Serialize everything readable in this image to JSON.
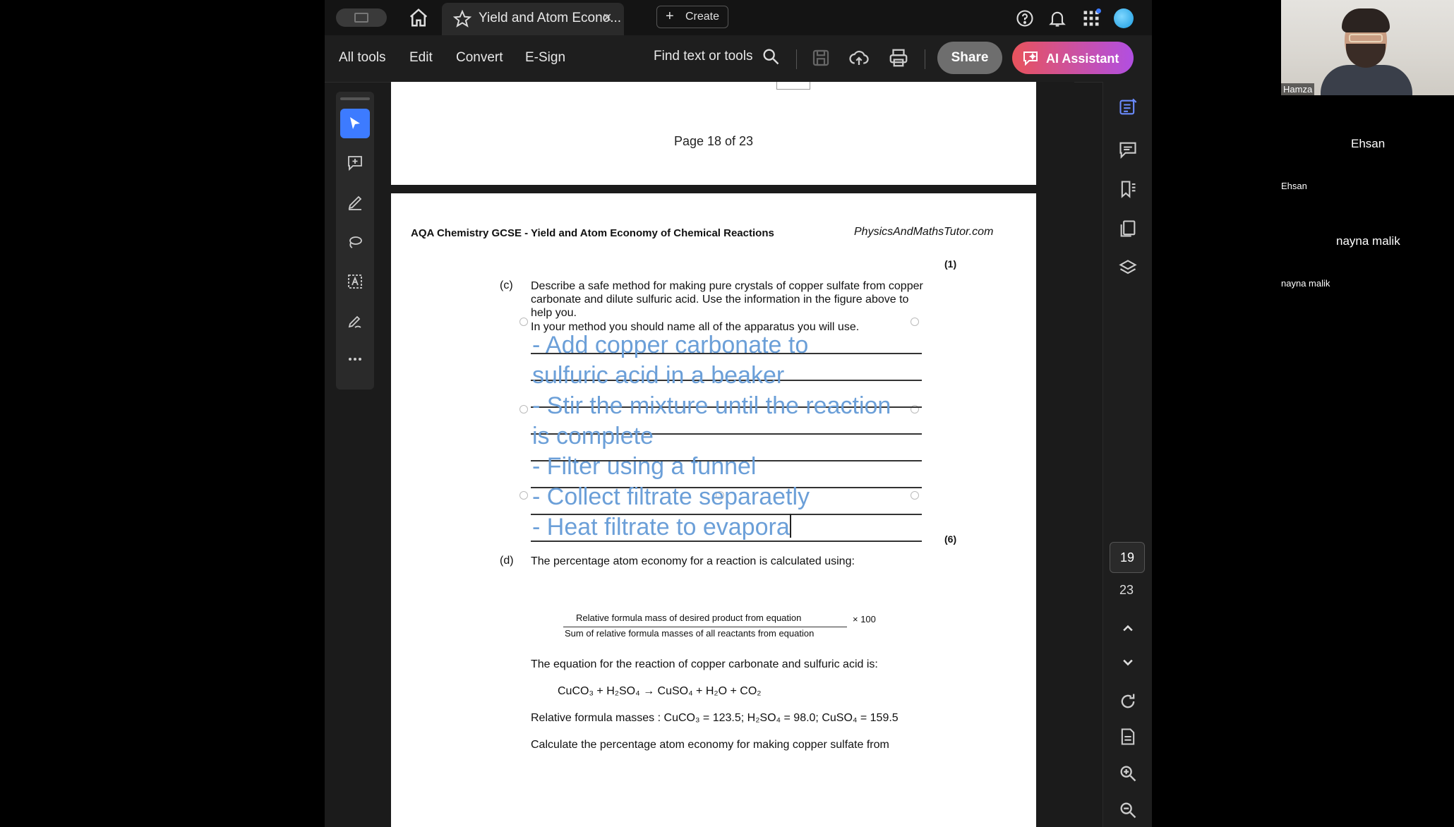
{
  "titlebar": {
    "tab_title": "Yield and Atom Econo...",
    "tab_close": "×",
    "create_label": "Create",
    "create_plus": "+"
  },
  "toolbar": {
    "menu": [
      "All tools",
      "Edit",
      "Convert",
      "E-Sign"
    ],
    "find_label": "Find text or tools",
    "share_label": "Share",
    "ai_label": "AI Assistant"
  },
  "document": {
    "prev_page_label": "Page  18  of  23",
    "header_left": "AQA Chemistry GCSE - Yield and Atom Economy of Chemical Reactions",
    "header_right": "PhysicsAndMathsTutor.com",
    "mark_top": "(1)",
    "q_c_label": "(c)",
    "q_c_text": "Describe a safe method for making pure crystals of copper sulfate from copper carbonate and dilute sulfuric acid. Use the information in the figure above to help you.",
    "q_c_instruction": "In your method you should name all of the apparatus you will use.",
    "handwritten": [
      "- Add copper carbonate to",
      "sulfuric acid in a beaker",
      "- Stir the mixture until the reaction",
      "is complete",
      "- Filter using a funnel",
      "- Collect filtrate separaetly",
      "- Heat filtrate to evapora"
    ],
    "mark_c": "(6)",
    "q_d_label": "(d)",
    "q_d_text": "The percentage atom economy for a reaction is calculated using:",
    "frac_numerator": "Relative  formula mass of  desired product  from equation",
    "frac_multiplier": "×  100",
    "frac_denominator": "Sum of relative  formula  masses of all reactants  from equation",
    "equation_intro": "The equation for the reaction of copper carbonate and sulfuric acid is:",
    "equation": "CuCO₃ + H₂SO₄ → CuSO₄ + H₂O + CO₂",
    "masses": "Relative formula masses : CuCO₃ = 123.5; H₂SO₄ = 98.0; CuSO₄ = 159.5",
    "calc": "Calculate the percentage atom economy for making copper sulfate from"
  },
  "page_nav": {
    "current": "19",
    "total": "23"
  },
  "meeting": {
    "host_label": "Hamza",
    "participants": [
      {
        "chip": "Ehsan",
        "label": "Ehsan"
      },
      {
        "chip": "nayna malik",
        "label": "nayna malik"
      }
    ]
  }
}
